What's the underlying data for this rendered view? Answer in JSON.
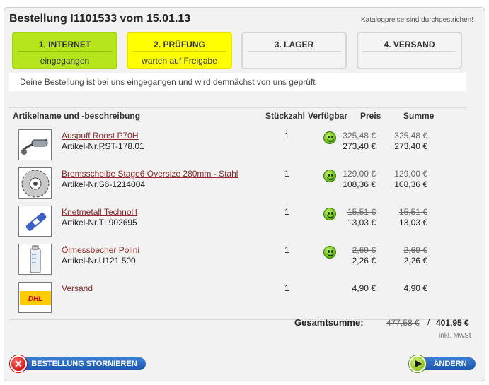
{
  "header": {
    "title": "Bestellung I1101533 vom 15.01.13",
    "note": "Katalogpreise sind durchgestrichen!"
  },
  "steps": [
    {
      "label": "1. INTERNET",
      "status": "eingegangen",
      "color": "#b5e61d"
    },
    {
      "label": "2. PRÜFUNG",
      "status": "warten auf Freigabe",
      "color": "#ffff00"
    },
    {
      "label": "3. LAGER",
      "status": ""
    },
    {
      "label": "4. VERSAND",
      "status": ""
    }
  ],
  "message": "Deine Bestellung ist bei uns eingegangen und wird demnächst von uns geprüft",
  "table": {
    "headers": {
      "name": "Artikelname und -beschreibung",
      "qty": "Stückzahl",
      "avail": "Verfügbar",
      "price": "Preis",
      "sum": "Summe"
    },
    "rows": [
      {
        "name": "Auspuff Roost P70H",
        "article": "Artikel-Nr.RST-178.01",
        "qty": "1",
        "available": "smiley-icon",
        "price_old": "325,48 €",
        "price": "273,40 €",
        "sum_old": "325,48 €",
        "sum": "273,40 €",
        "thumb": "exhaust-icon"
      },
      {
        "name": "Bremsscheibe Stage6 Oversize 280mm - Stahl",
        "article": "Artikel-Nr.S6-1214004",
        "qty": "1",
        "available": "smiley-icon",
        "price_old": "129,00 €",
        "price": "108,36 €",
        "sum_old": "129,00 €",
        "sum": "108,36 €",
        "thumb": "brake-disc-icon"
      },
      {
        "name": "Knetmetall Technolit",
        "article": "Artikel-Nr.TL902695",
        "qty": "1",
        "available": "smiley-icon",
        "price_old": "15,51 €",
        "price": "13,03 €",
        "sum_old": "15,51 €",
        "sum": "13,03 €",
        "thumb": "putty-tube-icon"
      },
      {
        "name": "Ölmessbecher Polini",
        "article": "Artikel-Nr.U121.500",
        "qty": "1",
        "available": "smiley-icon",
        "price_old": "2,69 €",
        "price": "2,26 €",
        "sum_old": "2,69 €",
        "sum": "2,26 €",
        "thumb": "measuring-cup-icon"
      },
      {
        "name": "Versand",
        "article": "",
        "qty": "1",
        "available": "",
        "price": "4,90 €",
        "sum": "4,90 €",
        "thumb": "dhl-logo"
      }
    ]
  },
  "total": {
    "label": "Gesamtsumme:",
    "old": "477,58 €",
    "separator": "/",
    "new": "401,95 €",
    "tax_note": "inkl. MwSt"
  },
  "buttons": {
    "cancel": "BESTELLUNG STORNIEREN",
    "change": "ÄNDERN"
  },
  "dhl_text": "DHL"
}
